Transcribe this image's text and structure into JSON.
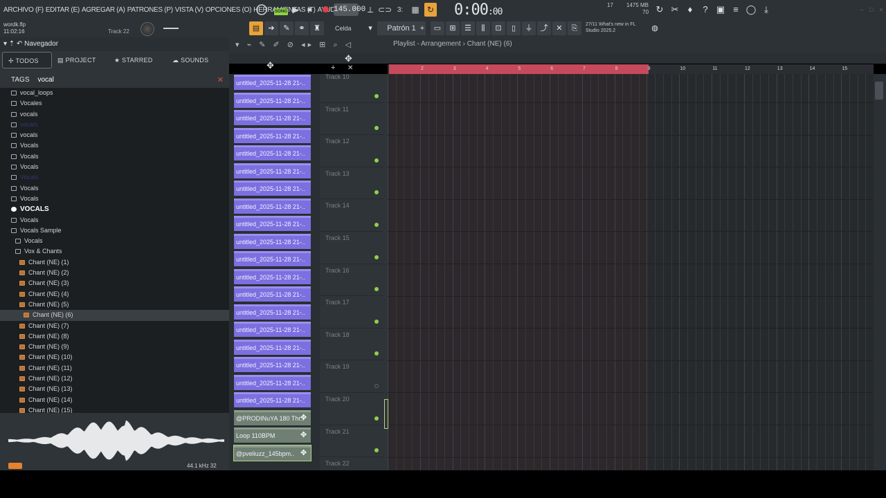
{
  "menu": [
    "ARCHIVO (F)",
    "EDITAR (E)",
    "AGREGAR (A)",
    "PATRONES (P)",
    "VISTA (V)",
    "OPCIONES (O)",
    "HERRAMIENTAS (T)",
    "AYUDA"
  ],
  "transport": {
    "song_label": "SONG",
    "tempo": "145.000",
    "time_main": "0:00",
    "time_small": ":00"
  },
  "status": {
    "cpu": "17",
    "mem": "1475 MB",
    "mem2": "70"
  },
  "file": {
    "name": "wordk.flp",
    "clock": "11:02:16",
    "track_hint": "Track 22"
  },
  "snap": {
    "label": "Celda"
  },
  "pattern": {
    "label": "Patrón 1"
  },
  "news": {
    "line1": "27/11  What's new in FL",
    "line2": "Studio 2025.2"
  },
  "browser": {
    "title": "Navegador",
    "tabs": [
      {
        "label": "TODOS"
      },
      {
        "label": "PROJECT"
      },
      {
        "label": "STARRED"
      },
      {
        "label": "SOUNDS"
      }
    ],
    "tags_label": "TAGS",
    "tags_value": "vocal",
    "rows": [
      {
        "label": "vocal_loops",
        "type": "folder",
        "dim": false
      },
      {
        "label": "Vocales",
        "type": "folder",
        "dim": false
      },
      {
        "label": "vocals",
        "type": "folder",
        "dim": false
      },
      {
        "label": "vocals",
        "type": "folder",
        "dim": true
      },
      {
        "label": "vocals",
        "type": "folder",
        "dim": false
      },
      {
        "label": "Vocals",
        "type": "folder",
        "dim": false
      },
      {
        "label": "Vocals",
        "type": "folder",
        "dim": false
      },
      {
        "label": "Vocals",
        "type": "folder",
        "dim": false
      },
      {
        "label": "Vocals",
        "type": "folder",
        "dim": true
      },
      {
        "label": "Vocals",
        "type": "folder",
        "dim": false
      },
      {
        "label": "Vocals",
        "type": "folder",
        "dim": false
      },
      {
        "label": "VOCALS",
        "type": "header",
        "dim": false
      },
      {
        "label": "Vocals",
        "type": "folder",
        "dim": false
      },
      {
        "label": "Vocals Sample",
        "type": "folder",
        "dim": false
      },
      {
        "label": "Vocals",
        "type": "folder",
        "dim": false,
        "indent": 1
      },
      {
        "label": "Vox & Chants",
        "type": "folder",
        "dim": false,
        "indent": 1
      },
      {
        "label": "Chant (NE) (1)",
        "type": "file",
        "indent": 2
      },
      {
        "label": "Chant (NE) (2)",
        "type": "file",
        "indent": 2
      },
      {
        "label": "Chant (NE) (3)",
        "type": "file",
        "indent": 2
      },
      {
        "label": "Chant (NE) (4)",
        "type": "file",
        "indent": 2
      },
      {
        "label": "Chant (NE) (5)",
        "type": "file",
        "indent": 2
      },
      {
        "label": "Chant (NE) (6)",
        "type": "file",
        "indent": 3,
        "selected": true
      },
      {
        "label": "Chant (NE) (7)",
        "type": "file",
        "indent": 2
      },
      {
        "label": "Chant (NE) (8)",
        "type": "file",
        "indent": 2
      },
      {
        "label": "Chant (NE) (9)",
        "type": "file",
        "indent": 2
      },
      {
        "label": "Chant (NE) (10)",
        "type": "file",
        "indent": 2
      },
      {
        "label": "Chant (NE) (11)",
        "type": "file",
        "indent": 2
      },
      {
        "label": "Chant (NE) (12)",
        "type": "file",
        "indent": 2
      },
      {
        "label": "Chant (NE) (13)",
        "type": "file",
        "indent": 2
      },
      {
        "label": "Chant (NE) (14)",
        "type": "file",
        "indent": 2
      },
      {
        "label": "Chant (NE) (15)",
        "type": "file",
        "indent": 2
      }
    ],
    "wave_info": "44.1 kHz 32"
  },
  "playlist": {
    "title": "Playlist - Arrangement › Chant (NE) (6)",
    "ruler": [
      "2",
      "3",
      "4",
      "5",
      "6",
      "7",
      "8",
      "9",
      "10",
      "11",
      "12",
      "13",
      "14",
      "15"
    ],
    "clips": [
      {
        "label": "untitled_2025-11-28 21-..",
        "kind": "pattern"
      },
      {
        "label": "untitled_2025-11-28 21-..",
        "kind": "pattern"
      },
      {
        "label": "untitled_2025-11-28 21-..",
        "kind": "pattern"
      },
      {
        "label": "untitled_2025-11-28 21-..",
        "kind": "pattern"
      },
      {
        "label": "untitled_2025-11-28 21-..",
        "kind": "pattern"
      },
      {
        "label": "untitled_2025-11-28 21-..",
        "kind": "pattern"
      },
      {
        "label": "untitled_2025-11-28 21-..",
        "kind": "pattern"
      },
      {
        "label": "untitled_2025-11-28 21-..",
        "kind": "pattern"
      },
      {
        "label": "untitled_2025-11-28 21-..",
        "kind": "pattern"
      },
      {
        "label": "untitled_2025-11-28 21-..",
        "kind": "pattern"
      },
      {
        "label": "untitled_2025-11-28 21-..",
        "kind": "pattern"
      },
      {
        "label": "untitled_2025-11-28 21-..",
        "kind": "pattern"
      },
      {
        "label": "untitled_2025-11-28 21-..",
        "kind": "pattern"
      },
      {
        "label": "untitled_2025-11-28 21-..",
        "kind": "pattern"
      },
      {
        "label": "untitled_2025-11-28 21-..",
        "kind": "pattern"
      },
      {
        "label": "untitled_2025-11-28 21-..",
        "kind": "pattern"
      },
      {
        "label": "untitled_2025-11-28 21-..",
        "kind": "pattern"
      },
      {
        "label": "untitled_2025-11-28 21-..",
        "kind": "pattern"
      },
      {
        "label": "untitled_2025-11-28 21-..",
        "kind": "pattern"
      },
      {
        "label": "@PRODINuYA 180 Thr..",
        "kind": "audio"
      },
      {
        "label": "Loop 110BPM",
        "kind": "audio"
      },
      {
        "label": "@pveliuzz_145bpm..",
        "kind": "audio",
        "selected": true
      }
    ],
    "tracks": [
      "Track 10",
      "Track 11",
      "Track 12",
      "Track 13",
      "Track 14",
      "Track 15",
      "Track 16",
      "Track 17",
      "Track 18",
      "Track 19",
      "Track 20",
      "Track 21",
      "Track 22"
    ]
  }
}
